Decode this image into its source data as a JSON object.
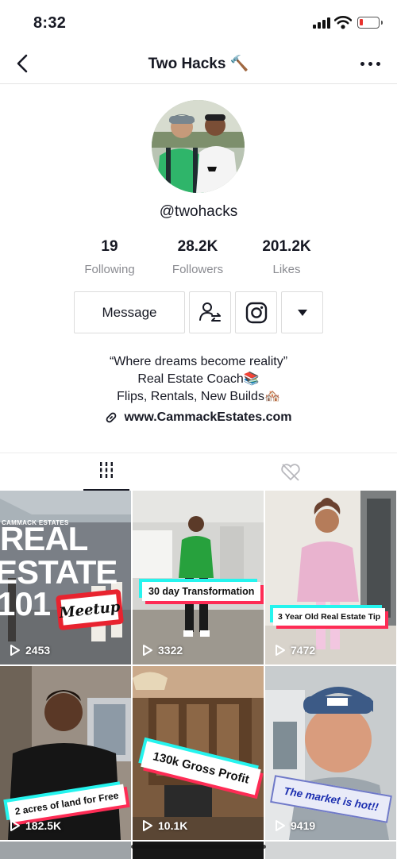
{
  "status": {
    "time": "8:32"
  },
  "nav": {
    "title": "Two Hacks 🔨"
  },
  "profile": {
    "username": "@twohacks",
    "stats": [
      {
        "num": "19",
        "label": "Following"
      },
      {
        "num": "28.2K",
        "label": "Followers"
      },
      {
        "num": "201.2K",
        "label": "Likes"
      }
    ],
    "message_label": "Message",
    "bio": [
      "“Where dreams become reality”",
      "Real Estate Coach📚",
      "Flips, Rentals, New Builds🏘️"
    ],
    "link": "www.CammackEstates.com"
  },
  "videos": [
    {
      "views": "2453",
      "caption": "Meetup",
      "overlay_small": "CAMMACK ESTATES",
      "overlay_big": [
        "REAL",
        "ESTATE",
        "101"
      ]
    },
    {
      "views": "3322",
      "caption": "30 day Transformation"
    },
    {
      "views": "7472",
      "caption": "3 Year Old Real Estate Tip"
    },
    {
      "views": "182.5K",
      "caption": "2 acres of land for Free"
    },
    {
      "views": "10.1K",
      "caption": "130k Gross Profit"
    },
    {
      "views": "9419",
      "caption": "The market is hot!!"
    }
  ],
  "colors": {
    "accent_cyan": "#25f4ee",
    "accent_red": "#fe2c55",
    "battery_low": "#e8312c"
  }
}
